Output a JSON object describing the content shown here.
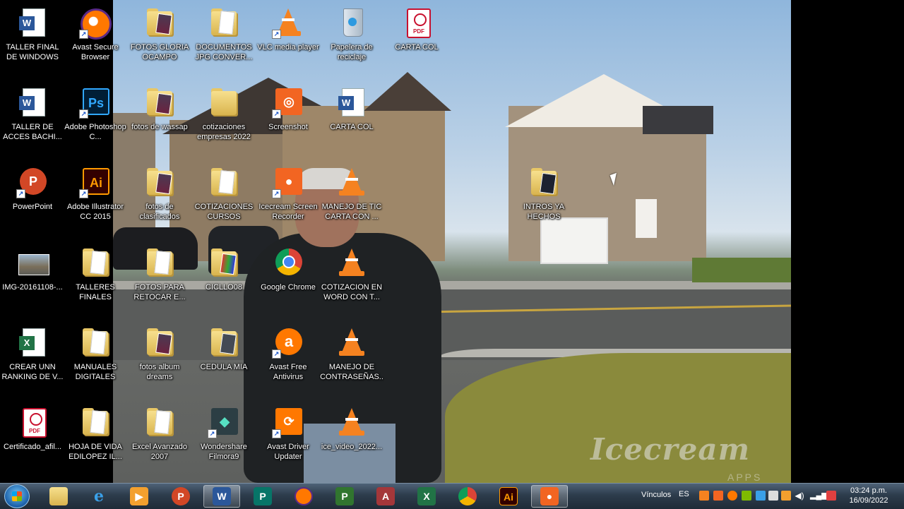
{
  "desktop": {
    "icons": [
      {
        "label": "TALLER FINAL DE WINDOWS",
        "icon": "word-icon"
      },
      {
        "label": "Avast Secure Browser",
        "icon": "avast-browser-icon"
      },
      {
        "label": "FOTOS GLORIA OCAMPO",
        "icon": "folder-icon"
      },
      {
        "label": "DOCUMENTOS JPG CONVER...",
        "icon": "folder-icon"
      },
      {
        "label": "VLC media player",
        "icon": "vlc-icon"
      },
      {
        "label": "Papelera de reciclaje",
        "icon": "recycle-bin-icon"
      },
      {
        "label": "CARTA COL",
        "icon": "pdf-icon"
      },
      {
        "label": "TALLER DE ACCES BACHI...",
        "icon": "word-icon"
      },
      {
        "label": "Adobe Photoshop C...",
        "icon": "photoshop-icon"
      },
      {
        "label": "fotos de wassap",
        "icon": "folder-icon"
      },
      {
        "label": "cotizaciones empresas 2022",
        "icon": "folder-icon"
      },
      {
        "label": "Screenshot",
        "icon": "icecream-screenshot-icon"
      },
      {
        "label": "CARTA COL",
        "icon": "word-icon"
      },
      {
        "label": "PowerPoint",
        "icon": "powerpoint-icon"
      },
      {
        "label": "Adobe Illustrator CC 2015",
        "icon": "illustrator-icon"
      },
      {
        "label": "fotos de clasificados",
        "icon": "folder-icon"
      },
      {
        "label": "COTIZACIONES CURSOS",
        "icon": "folder-icon"
      },
      {
        "label": "Icecream Screen Recorder",
        "icon": "icecream-recorder-icon"
      },
      {
        "label": "MANEJO DE TIC CARTA CON ...",
        "icon": "vlc-icon"
      },
      {
        "label": "INTROS YA HECHOS",
        "icon": "folder-icon"
      },
      {
        "label": "IMG-20161108-...",
        "icon": "image-thumbnail-icon"
      },
      {
        "label": "TALLERES FINALES",
        "icon": "folder-icon"
      },
      {
        "label": "FOTOS PARA RETOCAR E...",
        "icon": "folder-icon"
      },
      {
        "label": "CICLLO08",
        "icon": "folder-icon"
      },
      {
        "label": "Google Chrome",
        "icon": "chrome-icon"
      },
      {
        "label": "COTIZACION EN WORD CON T...",
        "icon": "vlc-icon"
      },
      {
        "label": "CREAR UNN RANKING DE V...",
        "icon": "excel-icon"
      },
      {
        "label": "MANUALES DIGITALES",
        "icon": "folder-icon"
      },
      {
        "label": "fotos album dreams",
        "icon": "folder-icon"
      },
      {
        "label": "CEDULA MIA",
        "icon": "folder-icon"
      },
      {
        "label": "Avast Free Antivirus",
        "icon": "avast-antivirus-icon"
      },
      {
        "label": "MANEJO DE CONTRASEÑAS...",
        "icon": "vlc-icon"
      },
      {
        "label": "Certificado_afil...",
        "icon": "pdf-icon"
      },
      {
        "label": "HOJA DE VIDA EDILOPEZ IL...",
        "icon": "folder-icon"
      },
      {
        "label": "Excel Avanzado 2007",
        "icon": "folder-icon"
      },
      {
        "label": "Wondershare Filmora9",
        "icon": "filmora-icon"
      },
      {
        "label": "Avast Driver Updater",
        "icon": "avast-driver-icon"
      },
      {
        "label": "ice_video_2022...",
        "icon": "vlc-icon"
      }
    ]
  },
  "watermark": {
    "text": "Icecream",
    "sub": "APPS"
  },
  "taskbar": {
    "items": [
      {
        "name": "file-explorer",
        "icon": "folder-icon"
      },
      {
        "name": "internet-explorer",
        "icon": "ie-icon"
      },
      {
        "name": "media-player",
        "icon": "media-player-icon"
      },
      {
        "name": "powerpoint",
        "icon": "powerpoint-icon"
      },
      {
        "name": "word",
        "icon": "word-icon"
      },
      {
        "name": "publisher",
        "icon": "publisher-icon"
      },
      {
        "name": "avast-browser",
        "icon": "avast-browser-icon"
      },
      {
        "name": "project",
        "icon": "project-icon"
      },
      {
        "name": "access",
        "icon": "access-icon"
      },
      {
        "name": "excel",
        "icon": "excel-icon"
      },
      {
        "name": "chrome",
        "icon": "chrome-icon"
      },
      {
        "name": "illustrator",
        "icon": "illustrator-icon"
      },
      {
        "name": "icecream-recorder",
        "icon": "icecream-recorder-icon"
      }
    ],
    "tray": {
      "links_label": "Vínculos",
      "language": "ES",
      "time": "03:24 p.m.",
      "date": "16/09/2022"
    }
  },
  "colors": {
    "word": "#2b579a",
    "excel": "#217346",
    "powerpoint": "#d24726",
    "photoshop": "#001e36",
    "illustrator": "#330000",
    "icecream": "#f26522",
    "vlc": "#f58220",
    "avast": "#ff7800"
  }
}
